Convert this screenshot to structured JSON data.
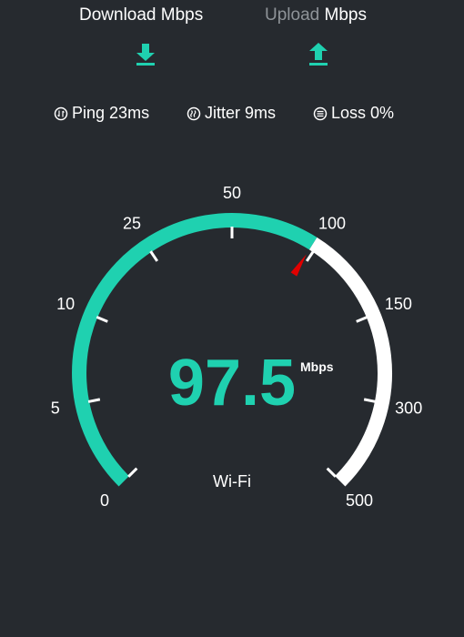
{
  "tabs": {
    "download": {
      "label": "Download",
      "unit": "Mbps"
    },
    "upload": {
      "label": "Upload",
      "unit": "Mbps"
    }
  },
  "icons": {
    "download": "download-arrow-icon",
    "upload": "upload-arrow-icon"
  },
  "stats": {
    "ping": {
      "label": "Ping",
      "value": "23ms",
      "icon": "ping-icon"
    },
    "jitter": {
      "label": "Jitter",
      "value": "9ms",
      "icon": "jitter-icon"
    },
    "loss": {
      "label": "Loss",
      "value": "0%",
      "icon": "loss-icon"
    }
  },
  "gauge": {
    "scale_labels": [
      "0",
      "5",
      "10",
      "25",
      "50",
      "100",
      "150",
      "300",
      "500"
    ],
    "scale_values": [
      0,
      5,
      10,
      25,
      50,
      100,
      150,
      300,
      500
    ],
    "current_value": 97.5,
    "display_value": "97.5",
    "unit": "Mbps",
    "connection": "Wi-Fi",
    "colors": {
      "active": "#1fd1b0",
      "inactive": "#ffffff",
      "needle": "#e00000",
      "background": "#262a2f"
    }
  }
}
